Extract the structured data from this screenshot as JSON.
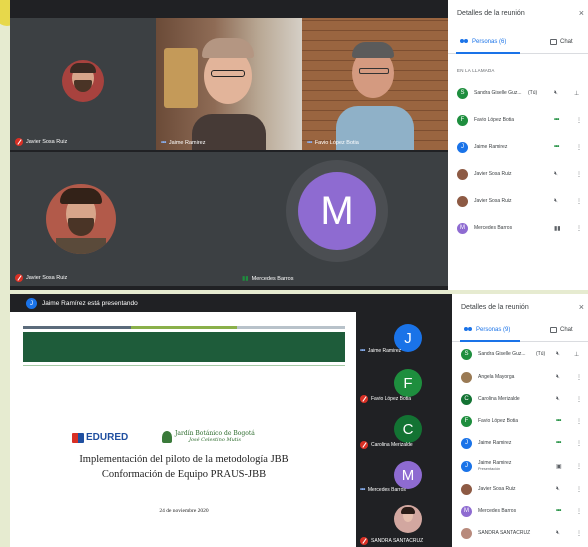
{
  "top": {
    "tiles": [
      {
        "name": "Javier Sosa Ruiz",
        "muted": true
      },
      {
        "name": "Jaime Ramirez",
        "speaking": true
      },
      {
        "name": "Favio López Botia",
        "speaking": true
      },
      {
        "name": "Javier Sosa Ruiz",
        "muted": true
      },
      {
        "name": "Mercedes Barros",
        "initial": "M",
        "talking": true
      }
    ],
    "panel": {
      "title": "Detalles de la reunión",
      "tab_people": "Personas (6)",
      "tab_chat": "Chat",
      "section": "EN LA LLAMADA",
      "participants": [
        {
          "initial": "S",
          "color": "#1e8e3e",
          "name": "Sandra Giselle Guz...",
          "tag": "(Tú)"
        },
        {
          "initial": "F",
          "color": "#1e8e3e",
          "name": "Favio López Botia"
        },
        {
          "initial": "J",
          "color": "#1a73e8",
          "name": "Jaime Ramirez"
        },
        {
          "initial": "",
          "color": "#8d5a44",
          "name": "Javier Sosa Ruiz"
        },
        {
          "initial": "",
          "color": "#8d5a44",
          "name": "Javier Sosa Ruiz"
        },
        {
          "initial": "M",
          "color": "#8e6bd1",
          "name": "Mercedes Barros"
        }
      ]
    }
  },
  "bottom": {
    "presenter_initial": "J",
    "presenter_text": "Jaime Ramírez está presentando",
    "slide": {
      "logo_left": "EDURED",
      "logo_right_1": "Jardín Botánico de Bogotá",
      "logo_right_2": "José Celestino Mutis",
      "title_1": "Implementación del piloto de la metodología JBB",
      "title_2": "Conformación de Equipo PRAUS-JBB",
      "date": "24 de noviembre 2020"
    },
    "strip": [
      {
        "initial": "J",
        "color": "#1a73e8",
        "name": "Jaime Ramirez"
      },
      {
        "initial": "F",
        "color": "#1e8e3e",
        "name": "Favio López Botia"
      },
      {
        "initial": "C",
        "color": "#137333",
        "name": "Carolina Merizalde"
      },
      {
        "initial": "M",
        "color": "#8e6bd1",
        "name": "Mercedes Barros"
      },
      {
        "initial": "",
        "color": "#d2a7a0",
        "name": "SANDRA SANTACRUZ"
      }
    ],
    "panel": {
      "title": "Detalles de la reunión",
      "tab_people": "Personas (9)",
      "tab_chat": "Chat",
      "participants": [
        {
          "initial": "S",
          "color": "#1e8e3e",
          "name": "Sandra Giselle Guz...",
          "tag": "(Tú)"
        },
        {
          "initial": "",
          "color": "#9a7a54",
          "name": "Angela Mayorga"
        },
        {
          "initial": "C",
          "color": "#137333",
          "name": "Carolina Merizalde"
        },
        {
          "initial": "F",
          "color": "#1e8e3e",
          "name": "Favio López Botia"
        },
        {
          "initial": "J",
          "color": "#1a73e8",
          "name": "Jaime Ramirez"
        },
        {
          "initial": "J",
          "color": "#1a73e8",
          "name": "Jaime Ramirez",
          "sub": "Presentación"
        },
        {
          "initial": "",
          "color": "#8d5a44",
          "name": "Javier Sosa Ruiz"
        },
        {
          "initial": "M",
          "color": "#8e6bd1",
          "name": "Mercedes Barros"
        },
        {
          "initial": "",
          "color": "#b88a7c",
          "name": "SANDRA SANTACRUZ"
        }
      ]
    }
  }
}
